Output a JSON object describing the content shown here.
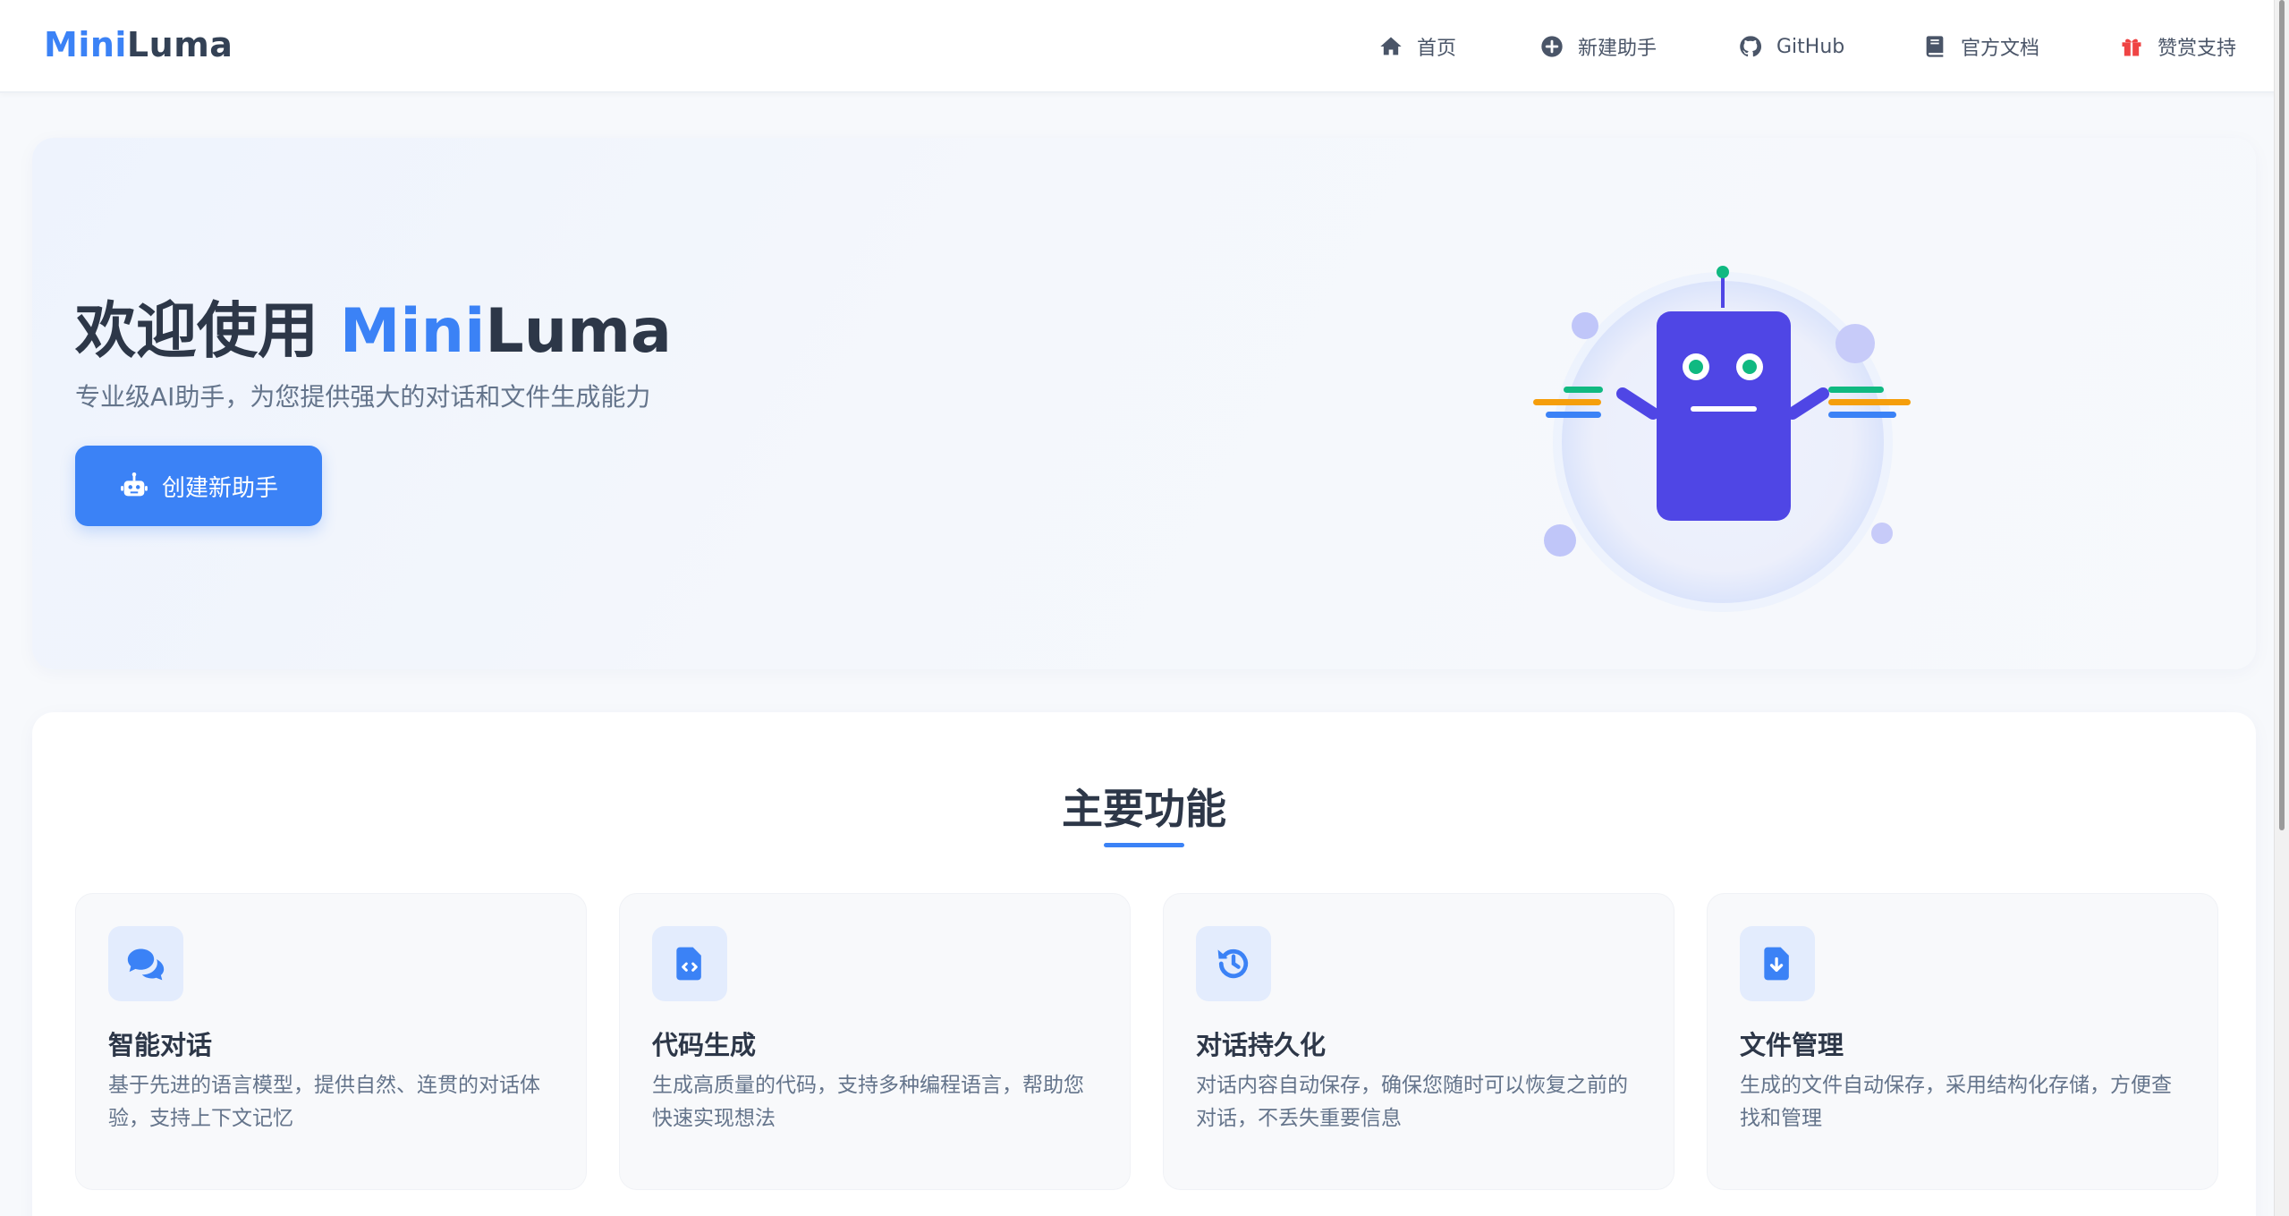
{
  "brand": {
    "part1": "Mini",
    "part2": "Luma"
  },
  "nav": {
    "home": "首页",
    "new_assistant": "新建助手",
    "github": "GitHub",
    "docs": "官方文档",
    "sponsor": "赞赏支持"
  },
  "hero": {
    "title_prefix": "欢迎使用 ",
    "title_mini": "Mini",
    "title_luma": "Luma",
    "subtitle": "专业级AI助手，为您提供强大的对话和文件生成能力",
    "button_label": "创建新助手"
  },
  "features": {
    "title": "主要功能",
    "items": [
      {
        "icon": "chat-bubbles-icon",
        "title": "智能对话",
        "desc": "基于先进的语言模型，提供自然、连贯的对话体验，支持上下文记忆"
      },
      {
        "icon": "code-file-icon",
        "title": "代码生成",
        "desc": "生成高质量的代码，支持多种编程语言，帮助您快速实现想法"
      },
      {
        "icon": "history-icon",
        "title": "对话持久化",
        "desc": "对话内容自动保存，确保您随时可以恢复之前的对话，不丢失重要信息"
      },
      {
        "icon": "file-download-icon",
        "title": "文件管理",
        "desc": "生成的文件自动保存，采用结构化存储，方便查找和管理"
      }
    ]
  },
  "colors": {
    "accent": "#3b82f6",
    "robot": "#4f46e5",
    "sponsor": "#ef4444"
  }
}
